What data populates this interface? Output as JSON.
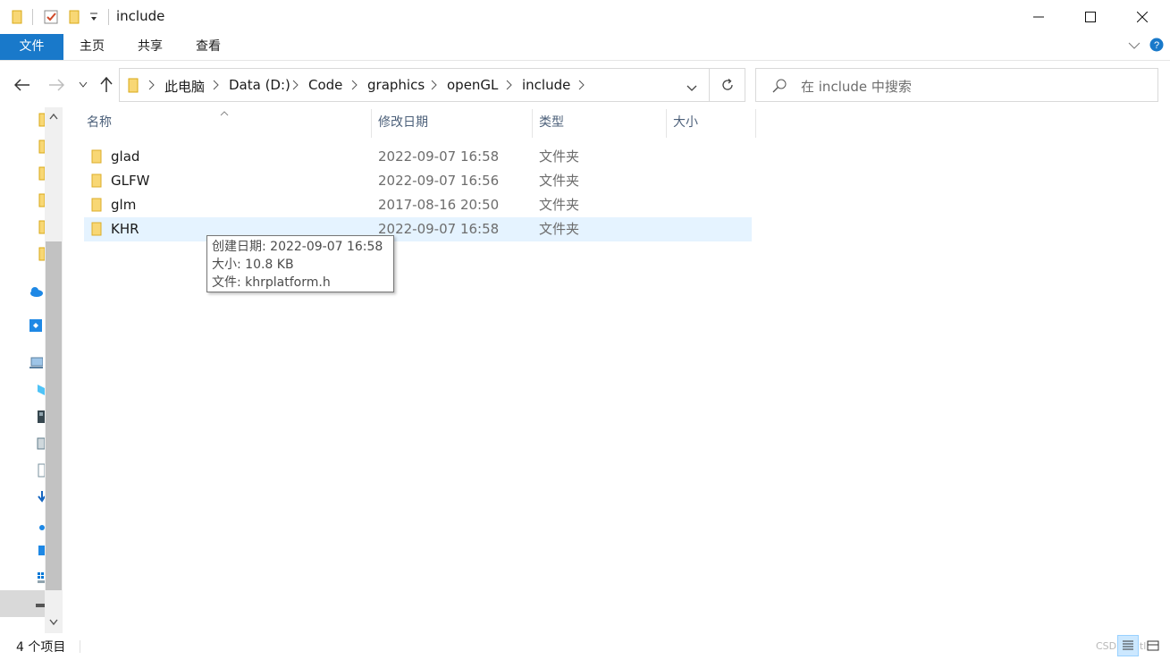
{
  "window": {
    "title": "include"
  },
  "ribbon": {
    "tabs": [
      "文件",
      "主页",
      "共享",
      "查看"
    ]
  },
  "address": {
    "segments": [
      "此电脑",
      "Data (D:)",
      "Code",
      "graphics",
      "openGL",
      "include"
    ]
  },
  "search": {
    "placeholder": "在 include 中搜索"
  },
  "columns": {
    "name": "名称",
    "date": "修改日期",
    "type": "类型",
    "size": "大小"
  },
  "files": [
    {
      "name": "glad",
      "date": "2022-09-07 16:58",
      "type": "文件夹"
    },
    {
      "name": "GLFW",
      "date": "2022-09-07 16:56",
      "type": "文件夹"
    },
    {
      "name": "glm",
      "date": "2017-08-16 20:50",
      "type": "文件夹"
    },
    {
      "name": "KHR",
      "date": "2022-09-07 16:58",
      "type": "文件夹"
    }
  ],
  "tooltip": {
    "line1": "创建日期: 2022-09-07 16:58",
    "line2": "大小: 10.8 KB",
    "line3": "文件: khrplatform.h"
  },
  "status": {
    "count": "4 个项目"
  },
  "watermark": "CSDN @ltl",
  "colors": {
    "accent": "#1979ca",
    "hover_row": "#e5f3ff",
    "folder": "#f8d775"
  }
}
